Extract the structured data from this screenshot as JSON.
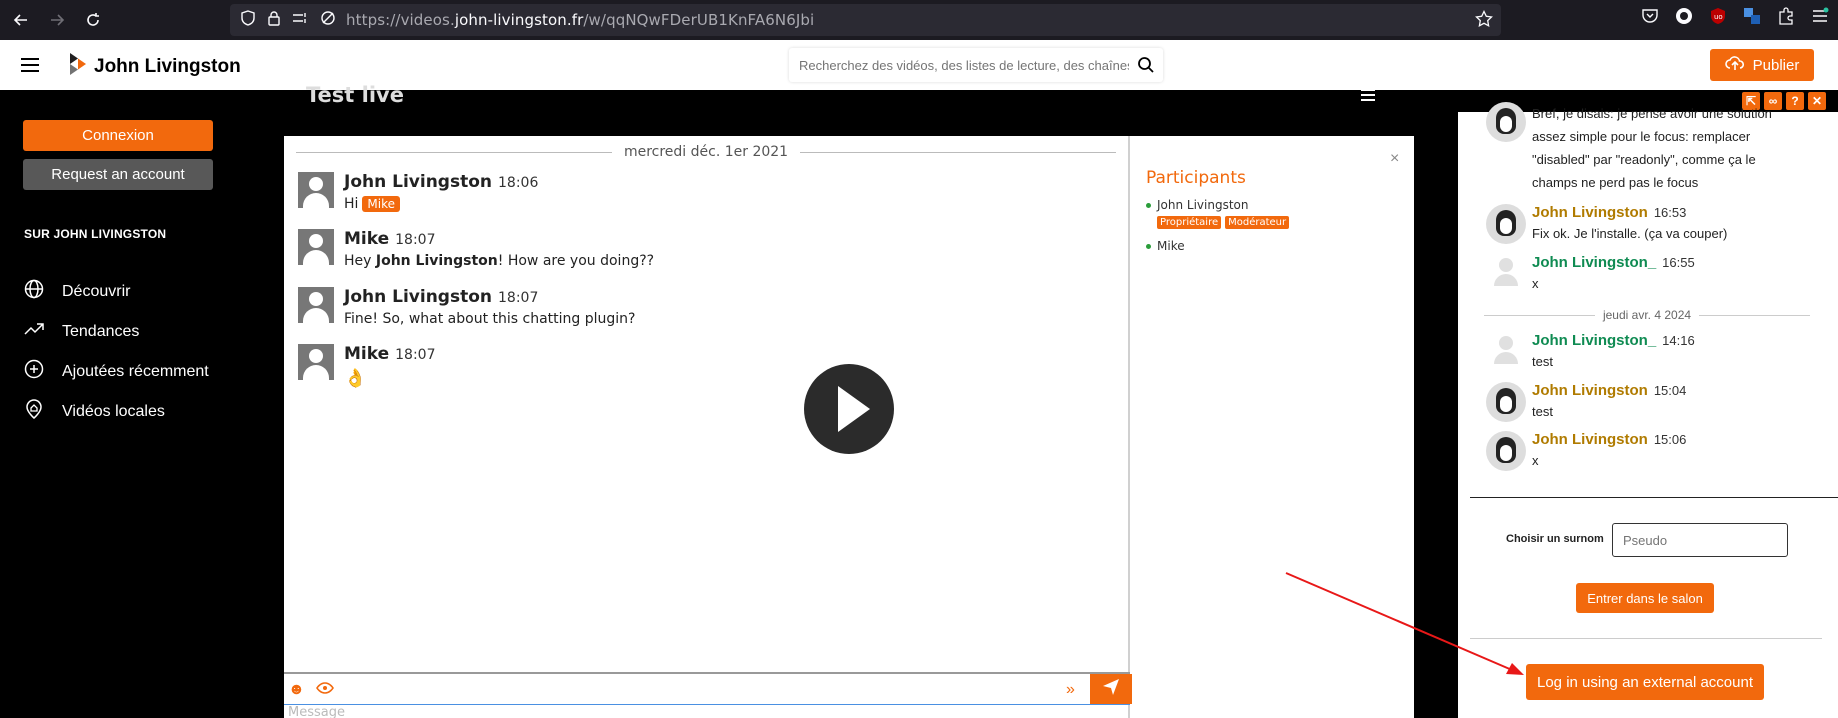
{
  "browser": {
    "url_prefix": "https://videos.",
    "url_domain": "john-livingston.fr",
    "url_path": "/w/qqNQwFDerUB1KnFA6N6Jbi"
  },
  "header": {
    "site_name": "John Livingston",
    "search_placeholder": "Recherchez des vidéos, des listes de lecture, des chaînes…",
    "publish_label": "Publier"
  },
  "sidebar": {
    "login_label": "Connexion",
    "request_label": "Request an account",
    "section_heading": "SUR JOHN LIVINGSTON",
    "items": [
      {
        "label": "Découvrir",
        "icon": "globe-icon"
      },
      {
        "label": "Tendances",
        "icon": "trending-icon"
      },
      {
        "label": "Ajoutées récemment",
        "icon": "plus-circle-icon"
      },
      {
        "label": "Vidéos locales",
        "icon": "home-pin-icon"
      }
    ]
  },
  "video": {
    "title": "Test live"
  },
  "embedded_chat": {
    "date": "mercredi déc. 1er 2021",
    "messages": [
      {
        "author": "John Livingston",
        "time": "18:06",
        "text": "Hi",
        "mention": "Mike"
      },
      {
        "author": "Mike",
        "time": "18:07",
        "text_pre": "Hey ",
        "text_bold": "John Livingston",
        "text_post": "! How are you doing??"
      },
      {
        "author": "John Livingston",
        "time": "18:07",
        "text": "Fine! So, what about this chatting plugin?"
      },
      {
        "author": "Mike",
        "time": "18:07",
        "text": "👌"
      }
    ],
    "participants_title": "Participants",
    "participants": [
      {
        "name": "John Livingston",
        "roles": [
          "Propriétaire",
          "Modérateur"
        ]
      },
      {
        "name": "Mike"
      }
    ],
    "message_placeholder": "Message"
  },
  "right_chat": {
    "first_message_lines": [
      "Bref, je disais: je pense avoir une solution",
      "assez simple pour le focus: remplacer",
      "\"disabled\" par \"readonly\", comme ça le",
      "champs ne perd pas le focus"
    ],
    "messages": [
      {
        "author": "John Livingston",
        "time": "16:53",
        "text": "Fix ok. Je l'installe. (ça va couper)"
      },
      {
        "author": "John Livingston_",
        "time": "16:55",
        "text": "x"
      },
      {
        "author": "John Livingston_",
        "time": "14:16",
        "text": "test"
      },
      {
        "author": "John Livingston",
        "time": "15:04",
        "text": "test"
      },
      {
        "author": "John Livingston",
        "time": "15:06",
        "text": "x"
      }
    ],
    "date_separator": "jeudi avr. 4 2024",
    "nickname_label": "Choisir un surnom",
    "nickname_placeholder": "Pseudo",
    "enter_label": "Entrer dans le salon",
    "external_login_label": "Log in using an external account"
  },
  "colors": {
    "accent": "#f2690d",
    "owner_gold": "#b07b00",
    "guest_green": "#0f8b52"
  }
}
